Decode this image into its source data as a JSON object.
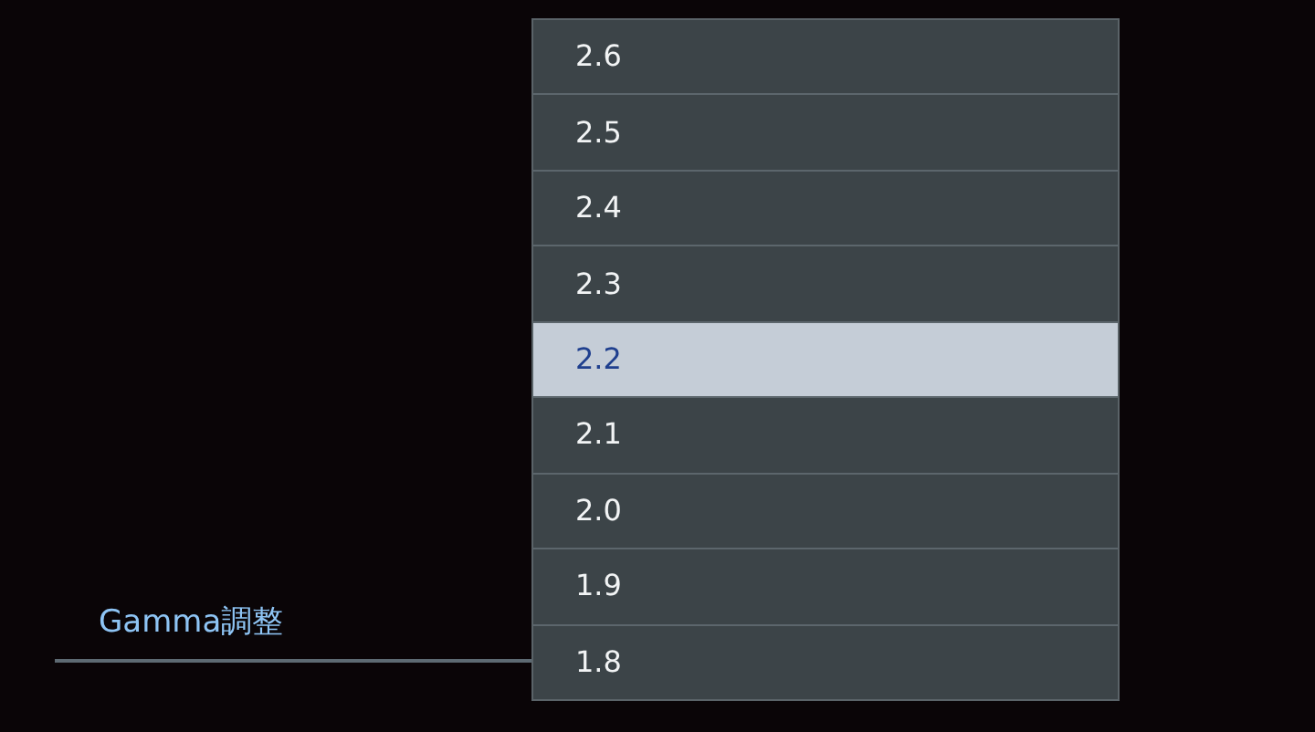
{
  "setting": {
    "label": "Gamma調整"
  },
  "options": [
    {
      "label": "2.6",
      "selected": false
    },
    {
      "label": "2.5",
      "selected": false
    },
    {
      "label": "2.4",
      "selected": false
    },
    {
      "label": "2.3",
      "selected": false
    },
    {
      "label": "2.2",
      "selected": true
    },
    {
      "label": "2.1",
      "selected": false
    },
    {
      "label": "2.0",
      "selected": false
    },
    {
      "label": "1.9",
      "selected": false
    },
    {
      "label": "1.8",
      "selected": false
    }
  ]
}
